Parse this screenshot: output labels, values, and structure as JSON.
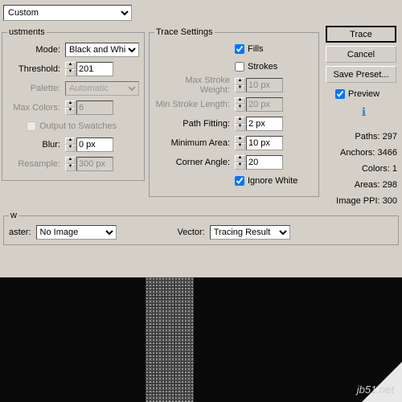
{
  "preset": {
    "value": "Custom"
  },
  "adjustments": {
    "legend": "ustments",
    "mode": {
      "label": "Mode:",
      "value": "Black and White"
    },
    "threshold": {
      "label": "Threshold:",
      "value": "201"
    },
    "palette": {
      "label": "Palette:",
      "value": "Automatic"
    },
    "maxColors": {
      "label": "Max Colors:",
      "value": "6"
    },
    "outputSwatches": {
      "label": "Output to Swatches"
    },
    "blur": {
      "label": "Blur:",
      "value": "0 px"
    },
    "resample": {
      "label": "Resample:",
      "value": "300 px"
    }
  },
  "trace": {
    "legend": "Trace Settings",
    "fills": {
      "label": "Fills",
      "checked": true
    },
    "strokes": {
      "label": "Strokes",
      "checked": false
    },
    "maxStrokeWeight": {
      "label": "Max Stroke Weight:",
      "value": "10 px"
    },
    "minStrokeLength": {
      "label": "Min Stroke Length:",
      "value": "20 px"
    },
    "pathFitting": {
      "label": "Path Fitting:",
      "value": "2 px"
    },
    "minimumArea": {
      "label": "Minimum Area:",
      "value": "10 px"
    },
    "cornerAngle": {
      "label": "Corner Angle:",
      "value": "20"
    },
    "ignoreWhite": {
      "label": "Ignore White",
      "checked": true
    }
  },
  "buttons": {
    "trace": "Trace",
    "cancel": "Cancel",
    "savePreset": "Save Preset..."
  },
  "preview": {
    "label": "Preview",
    "checked": true
  },
  "stats": {
    "paths": {
      "label": "Paths:",
      "value": "297"
    },
    "anchors": {
      "label": "Anchors:",
      "value": "3466"
    },
    "colors": {
      "label": "Colors:",
      "value": "1"
    },
    "areas": {
      "label": "Areas:",
      "value": "298"
    },
    "ppi": {
      "label": "Image PPI:",
      "value": "300"
    }
  },
  "view": {
    "legend": "w",
    "raster": {
      "label": "aster:",
      "value": "No Image"
    },
    "vector": {
      "label": "Vector:",
      "value": "Tracing Result"
    }
  },
  "watermark": "jb51.net"
}
